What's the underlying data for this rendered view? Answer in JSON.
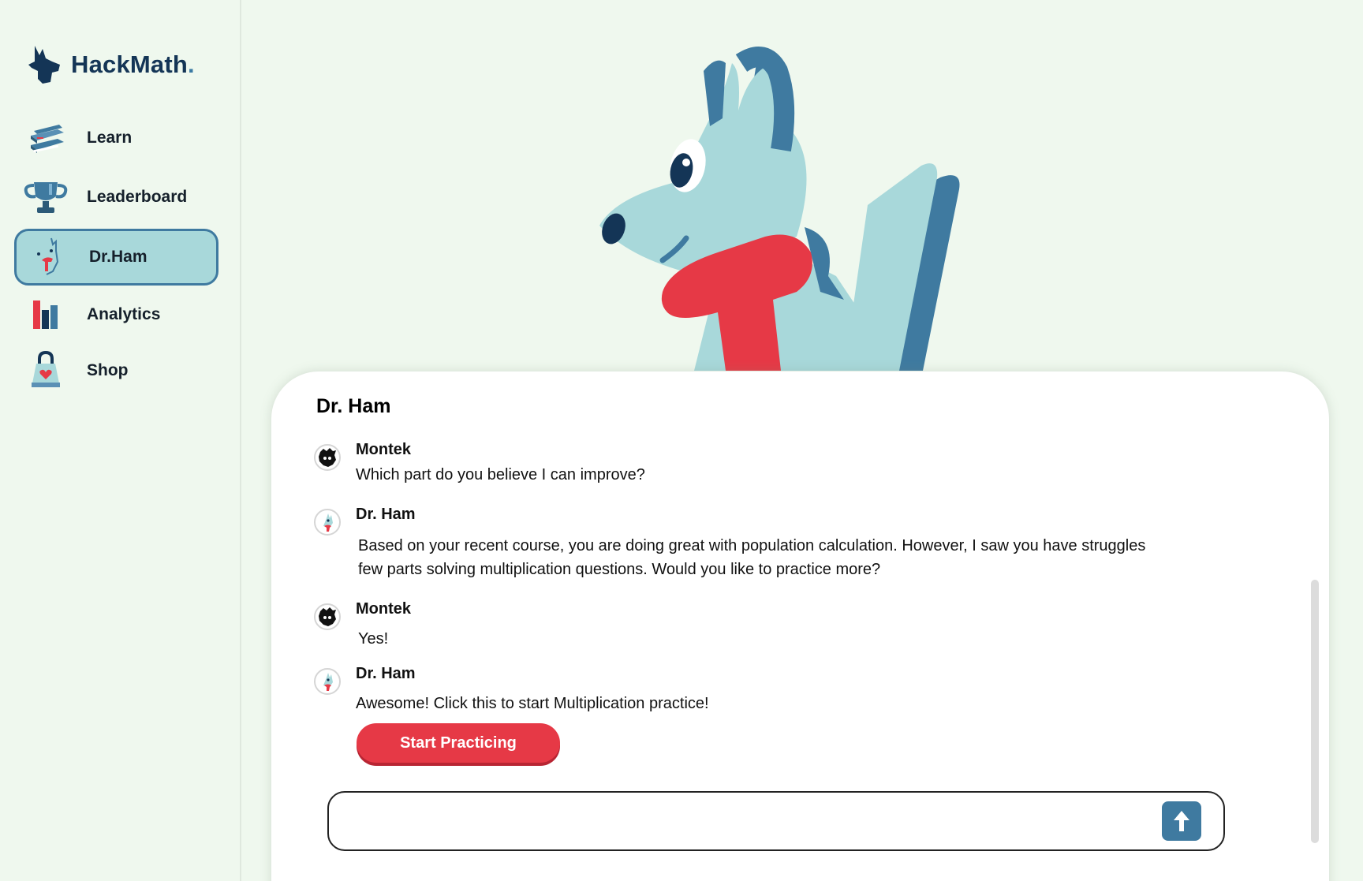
{
  "app": {
    "brand": "HackMath",
    "brand_dot": "."
  },
  "sidebar": {
    "items": [
      {
        "label": "Learn",
        "icon": "books-icon"
      },
      {
        "label": "Leaderboard",
        "icon": "trophy-icon"
      },
      {
        "label": "Dr.Ham",
        "icon": "dr-ham-icon",
        "active": true
      },
      {
        "label": "Analytics",
        "icon": "bar-chart-icon"
      },
      {
        "label": "Shop",
        "icon": "shopping-bag-icon"
      }
    ]
  },
  "chat": {
    "title": "Dr. Ham",
    "messages": [
      {
        "sender": "Montek",
        "lines": [
          "Which part do you believe I can improve?"
        ]
      },
      {
        "sender": "Dr. Ham",
        "lines": [
          "Based on your recent course, you are doing great with population calculation. However, I saw you have struggles",
          "few parts solving multiplication questions. Would you like to practice more?"
        ]
      },
      {
        "sender": "Montek",
        "lines": [
          "Yes!"
        ]
      },
      {
        "sender": "Dr. Ham",
        "lines": [
          "Awesome! Click this to start Multiplication practice!"
        ]
      }
    ],
    "action_button": "Start Practicing",
    "input": {
      "value": "",
      "placeholder": ""
    },
    "send_icon": "arrow-up-icon"
  },
  "colors": {
    "background": "#eff8ee",
    "accent_red": "#e63946",
    "accent_blue": "#3f7aa0",
    "dog_light": "#a8d8da",
    "brand_navy": "#143556"
  }
}
